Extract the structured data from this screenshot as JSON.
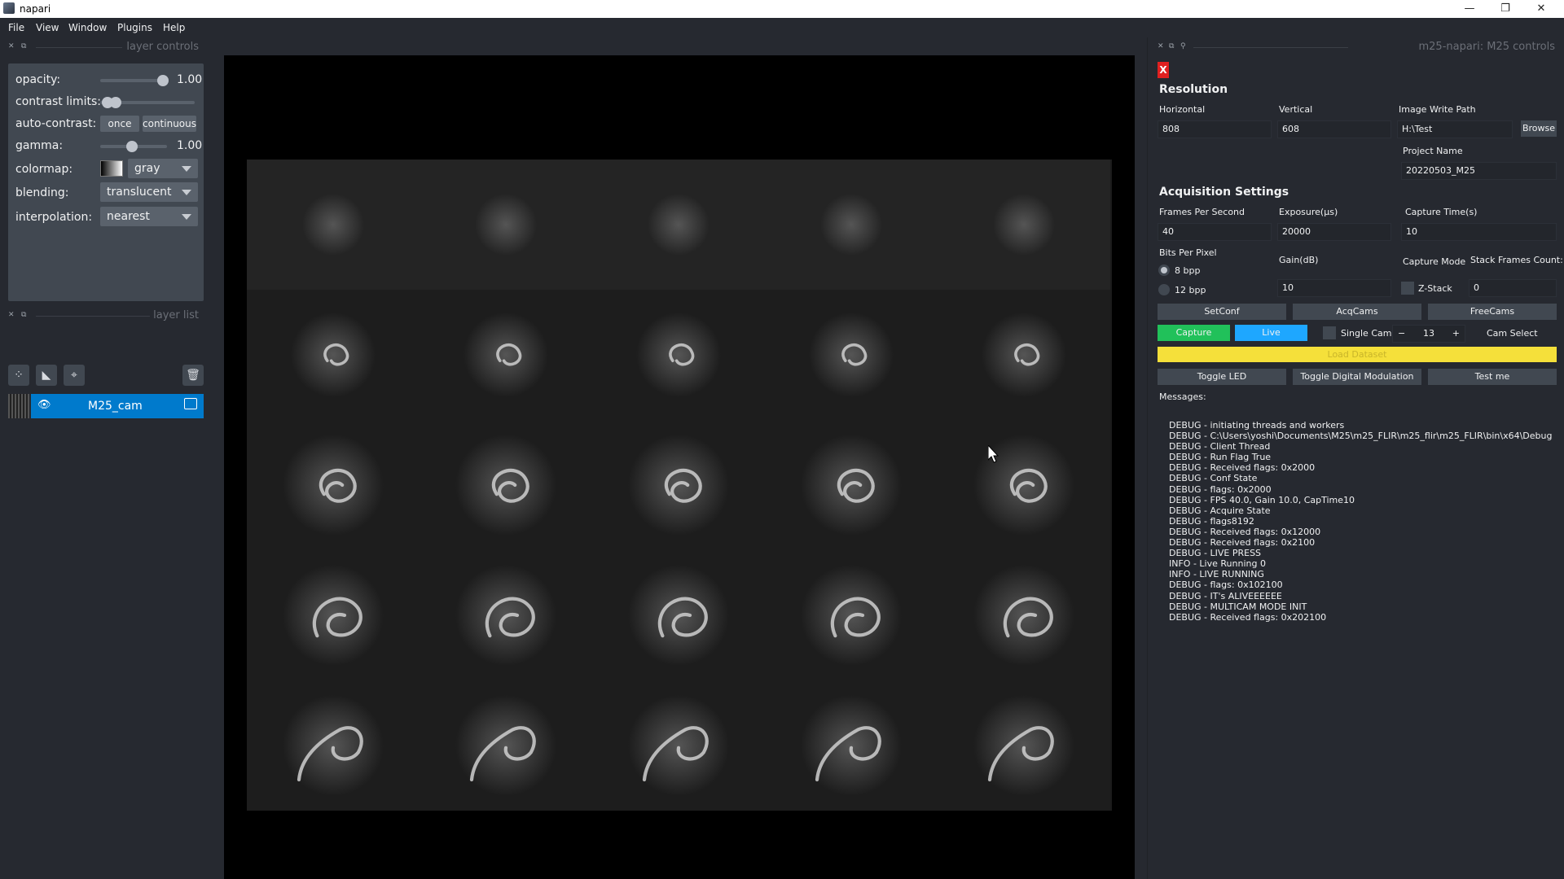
{
  "window": {
    "title": "napari",
    "min": "—",
    "max": "❐",
    "close": "✕"
  },
  "menu": [
    "File",
    "View",
    "Window",
    "Plugins",
    "Help"
  ],
  "layer_controls": {
    "header": "layer controls",
    "opacity_label": "opacity:",
    "opacity_value": "1.00",
    "opacity": 1.0,
    "contrast_label": "contrast limits:",
    "autocontrast_label": "auto-contrast:",
    "once": "once",
    "continuous": "continuous",
    "gamma_label": "gamma:",
    "gamma_value": "1.00",
    "colormap_label": "colormap:",
    "colormap_value": "gray",
    "blending_label": "blending:",
    "blending_value": "translucent",
    "interpolation_label": "interpolation:",
    "interpolation_value": "nearest"
  },
  "layer_list": {
    "header": "layer list",
    "layers": [
      {
        "name": "M25_cam"
      }
    ]
  },
  "m25": {
    "header": "m25-napari: M25 controls",
    "close_x": "X",
    "resolution_title": "Resolution",
    "horizontal_label": "Horizontal",
    "horizontal_value": "808",
    "vertical_label": "Vertical",
    "vertical_value": "608",
    "write_path_label": "Image Write Path",
    "write_path_value": "H:\\Test",
    "browse": "Browse",
    "project_label": "Project Name",
    "project_value": "20220503_M25",
    "acq_title": "Acquisition Settings",
    "fps_label": "Frames Per Second",
    "fps_value": "40",
    "exposure_label": "Exposure(µs)",
    "exposure_value": "20000",
    "capture_time_label": "Capture Time(s)",
    "capture_time_value": "10",
    "bpp_label": "Bits Per Pixel",
    "bpp8": "8 bpp",
    "bpp12": "12 bpp",
    "gain_label": "Gain(dB)",
    "gain_value": "10",
    "capture_mode_label": "Capture Mode",
    "zstack": "Z-Stack",
    "stack_frames_label": "Stack Frames Count:",
    "stack_frames_value": "0",
    "setconf": "SetConf",
    "acqcams": "AcqCams",
    "freecams": "FreeCams",
    "capture": "Capture",
    "live": "Live",
    "single_cam": "Single Cam",
    "cam_select_value": "13",
    "cam_select_label": "Cam Select",
    "load_dataset": "Load Dataset",
    "toggle_led": "Toggle LED",
    "toggle_dm": "Toggle Digital Modulation",
    "test_me": "Test me",
    "messages_label": "Messages:",
    "messages": [
      "DEBUG - initiating threads and workers",
      "DEBUG - C:\\Users\\yoshi\\Documents\\M25\\m25_FLIR\\m25_flir\\m25_FLIR\\bin\\x64\\Debug",
      "DEBUG - Client Thread",
      "DEBUG - Run Flag True",
      "DEBUG - Received flags: 0x2000",
      "DEBUG - Conf State",
      "DEBUG - flags: 0x2000",
      "DEBUG - FPS 40.0, Gain 10.0, CapTime10",
      "DEBUG - Acquire State",
      "DEBUG - flags8192",
      "DEBUG - Received flags: 0x12000",
      "DEBUG - Received flags: 0x2100",
      "DEBUG - LIVE PRESS",
      "INFO - Live Running 0",
      "INFO - LIVE RUNNING",
      "DEBUG - flags: 0x102100",
      "DEBUG - IT's ALIVEEEEEE",
      "DEBUG - MULTICAM MODE INIT",
      "DEBUG - Received flags: 0x202100"
    ]
  },
  "colors": {
    "accent": "#007acc",
    "capture": "#21c15a",
    "live": "#1ea7ff",
    "load": "#f5e03a",
    "close": "#e02020"
  }
}
